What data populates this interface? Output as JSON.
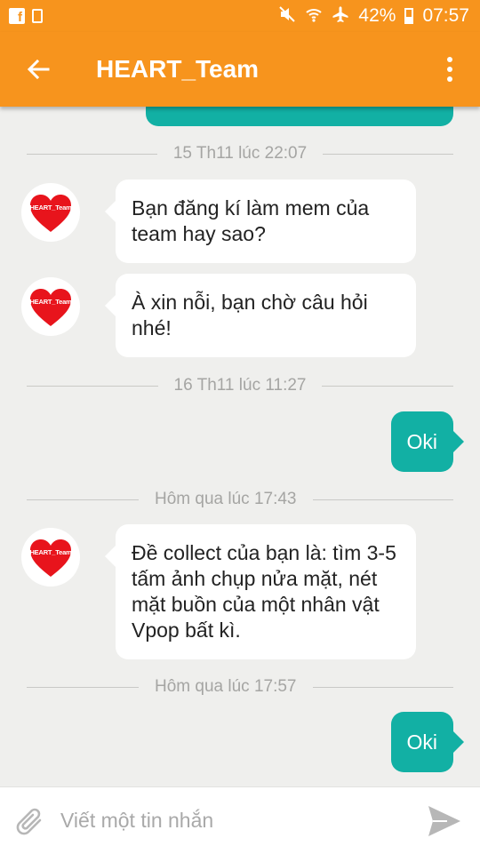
{
  "status_bar": {
    "battery": "42%",
    "time": "07:57"
  },
  "app_bar": {
    "title": "HEART_Team"
  },
  "avatar_label": "HEART_Team",
  "chat": {
    "dividers": [
      "15 Th11 lúc 22:07",
      "16 Th11 lúc 11:27",
      "Hôm qua lúc 17:43",
      "Hôm qua lúc 17:57"
    ],
    "incoming": [
      "Bạn đăng kí làm mem của team hay sao?",
      "À xin nỗi, bạn chờ câu hỏi nhé!",
      "Đề collect của bạn là: tìm 3-5 tấm ảnh chụp nửa mặt, nét mặt buồn của một nhân vật Vpop bất kì."
    ],
    "outgoing": [
      "Oki",
      "Oki"
    ]
  },
  "composer": {
    "placeholder": "Viết một tin nhắn"
  },
  "colors": {
    "brand_orange": "#f7941d",
    "outgoing_teal": "#12b0a4",
    "background": "#efefed"
  }
}
